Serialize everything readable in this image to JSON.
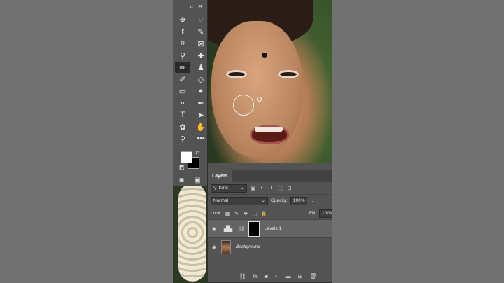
{
  "toolbar": {
    "header": {
      "collapse": "«",
      "close": "✕"
    },
    "tools": [
      {
        "name": "move-icon",
        "glyph": "✥"
      },
      {
        "name": "marquee-icon",
        "glyph": "◌"
      },
      {
        "name": "lasso-icon",
        "glyph": "ℓ"
      },
      {
        "name": "quick-select-icon",
        "glyph": "✎"
      },
      {
        "name": "crop-icon",
        "glyph": "⌗"
      },
      {
        "name": "frame-icon",
        "glyph": "⊠"
      },
      {
        "name": "eyedropper-icon",
        "glyph": "⚲"
      },
      {
        "name": "healing-brush-icon",
        "glyph": "✚"
      },
      {
        "name": "brush-icon",
        "glyph": "✏"
      },
      {
        "name": "clone-stamp-icon",
        "glyph": "♟"
      },
      {
        "name": "history-brush-icon",
        "glyph": "✐"
      },
      {
        "name": "eraser-icon",
        "glyph": "◇"
      },
      {
        "name": "gradient-icon",
        "glyph": "▭"
      },
      {
        "name": "blur-icon",
        "glyph": "●"
      },
      {
        "name": "dodge-icon",
        "glyph": "⚬"
      },
      {
        "name": "pen-icon",
        "glyph": "✒"
      },
      {
        "name": "type-icon",
        "glyph": "T"
      },
      {
        "name": "path-select-icon",
        "glyph": "➤"
      },
      {
        "name": "shape-icon",
        "glyph": "✿"
      },
      {
        "name": "hand-icon",
        "glyph": "✋"
      },
      {
        "name": "zoom-icon",
        "glyph": "⚲"
      },
      {
        "name": "more-tools-icon",
        "glyph": "•••"
      }
    ],
    "swap": "⇄",
    "reset": "◩",
    "bottom": {
      "quick-mask": "◙",
      "screen-mode": "▣"
    }
  },
  "layers_panel": {
    "top_controls": {
      "collapse": "«",
      "close": "✕"
    },
    "tab": "Layers",
    "menu": "≡",
    "filter": {
      "kind": "Kind",
      "kind_icon": "⚲",
      "icons": [
        "▣",
        "◐",
        "T",
        "⬚",
        "⊡"
      ]
    },
    "blend_mode": "Normal",
    "opacity_label": "Opacity:",
    "opacity_value": "100%",
    "lock_label": "Lock:",
    "lock_icons": [
      "▦",
      "✎",
      "✥",
      "⬚",
      "🔒"
    ],
    "fill_label": "Fill:",
    "fill_value": "100%",
    "layers": [
      {
        "name": "Levels 1",
        "type": "adjustment",
        "adj_glyph": "▟▙",
        "eye": "◉",
        "chain": "⛓",
        "selected": true
      },
      {
        "name": "Background",
        "type": "photo",
        "eye": "◉",
        "lock": "🔒",
        "selected": false
      }
    ],
    "footer_icons": [
      {
        "name": "link-layers-icon",
        "glyph": "⛓"
      },
      {
        "name": "fx-icon",
        "glyph": "fx"
      },
      {
        "name": "add-mask-icon",
        "glyph": "◙"
      },
      {
        "name": "adjustment-icon",
        "glyph": "◐"
      },
      {
        "name": "group-icon",
        "glyph": "▬"
      },
      {
        "name": "new-layer-icon",
        "glyph": "⊞"
      },
      {
        "name": "delete-layer-icon",
        "glyph": "🗑"
      }
    ]
  }
}
